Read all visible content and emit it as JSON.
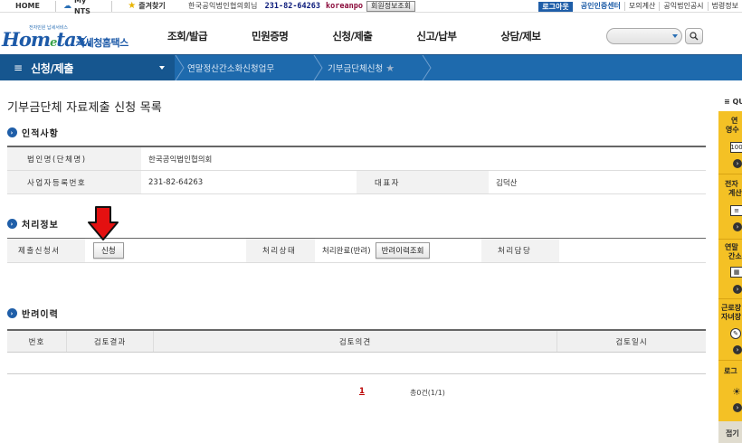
{
  "topbar": {
    "home": "HOME",
    "mynts": "My NTS",
    "favorites": "즐겨찾기",
    "user": "한국공익법인협의회님",
    "bizno": "231-82-64263",
    "uid": "koreanpo",
    "member_info": "회원정보조회",
    "logout": "로그아웃",
    "links": [
      "공인인증센터",
      "모의계산",
      "공익법인공시",
      "법령정보"
    ]
  },
  "header": {
    "logo_small": "전자민원 납세서비스",
    "logo_home": "Hom",
    "logo_e": "e",
    "logo_tax": "tax.",
    "logo_kr": "국세청홈택스",
    "gnb": [
      "조회/발급",
      "민원증명",
      "신청/제출",
      "신고/납부",
      "상담/제보"
    ]
  },
  "nav": {
    "main": "신청/제출",
    "crumb1": "연말정산간소화신청업무",
    "crumb2": "기부금단체신청"
  },
  "page": {
    "title": "기부금단체 자료제출 신청 목록",
    "section_personal": "인적사항",
    "personal": {
      "corp_name_label": "법인명(단체명)",
      "corp_name": "한국공익법인협의회",
      "bizno_label": "사업자등록번호",
      "bizno": "231-82-64263",
      "rep_label": "대표자",
      "rep": "김덕산"
    },
    "section_process": "처리정보",
    "process": {
      "submit_doc_label": "제출신청서",
      "apply_button": "신청",
      "status_label": "처리상태",
      "status": "처리완료(반려)",
      "history_button": "반려이력조회",
      "manager_label": "처리담당"
    },
    "section_reject": "반려이력",
    "reject_columns": [
      "번호",
      "검토결과",
      "검토의견",
      "검토일시"
    ],
    "pager_current": "1",
    "total": "총0건(1/1)"
  },
  "quick": {
    "header": "≡ QU",
    "items": [
      {
        "line1": "연",
        "line2": "영수"
      },
      {
        "line1": "전자",
        "line2": "계산"
      },
      {
        "line1": "연말",
        "line2": "간소"
      },
      {
        "line1": "근로장",
        "line2": "자녀장"
      },
      {
        "line1": "로그",
        "line2": ""
      }
    ],
    "footer": "접기"
  },
  "colors": {
    "brand": "#1d5aa8",
    "nav_band": "#1e6aad",
    "quick_panel": "#f4c125",
    "arrow": "#e41010"
  }
}
